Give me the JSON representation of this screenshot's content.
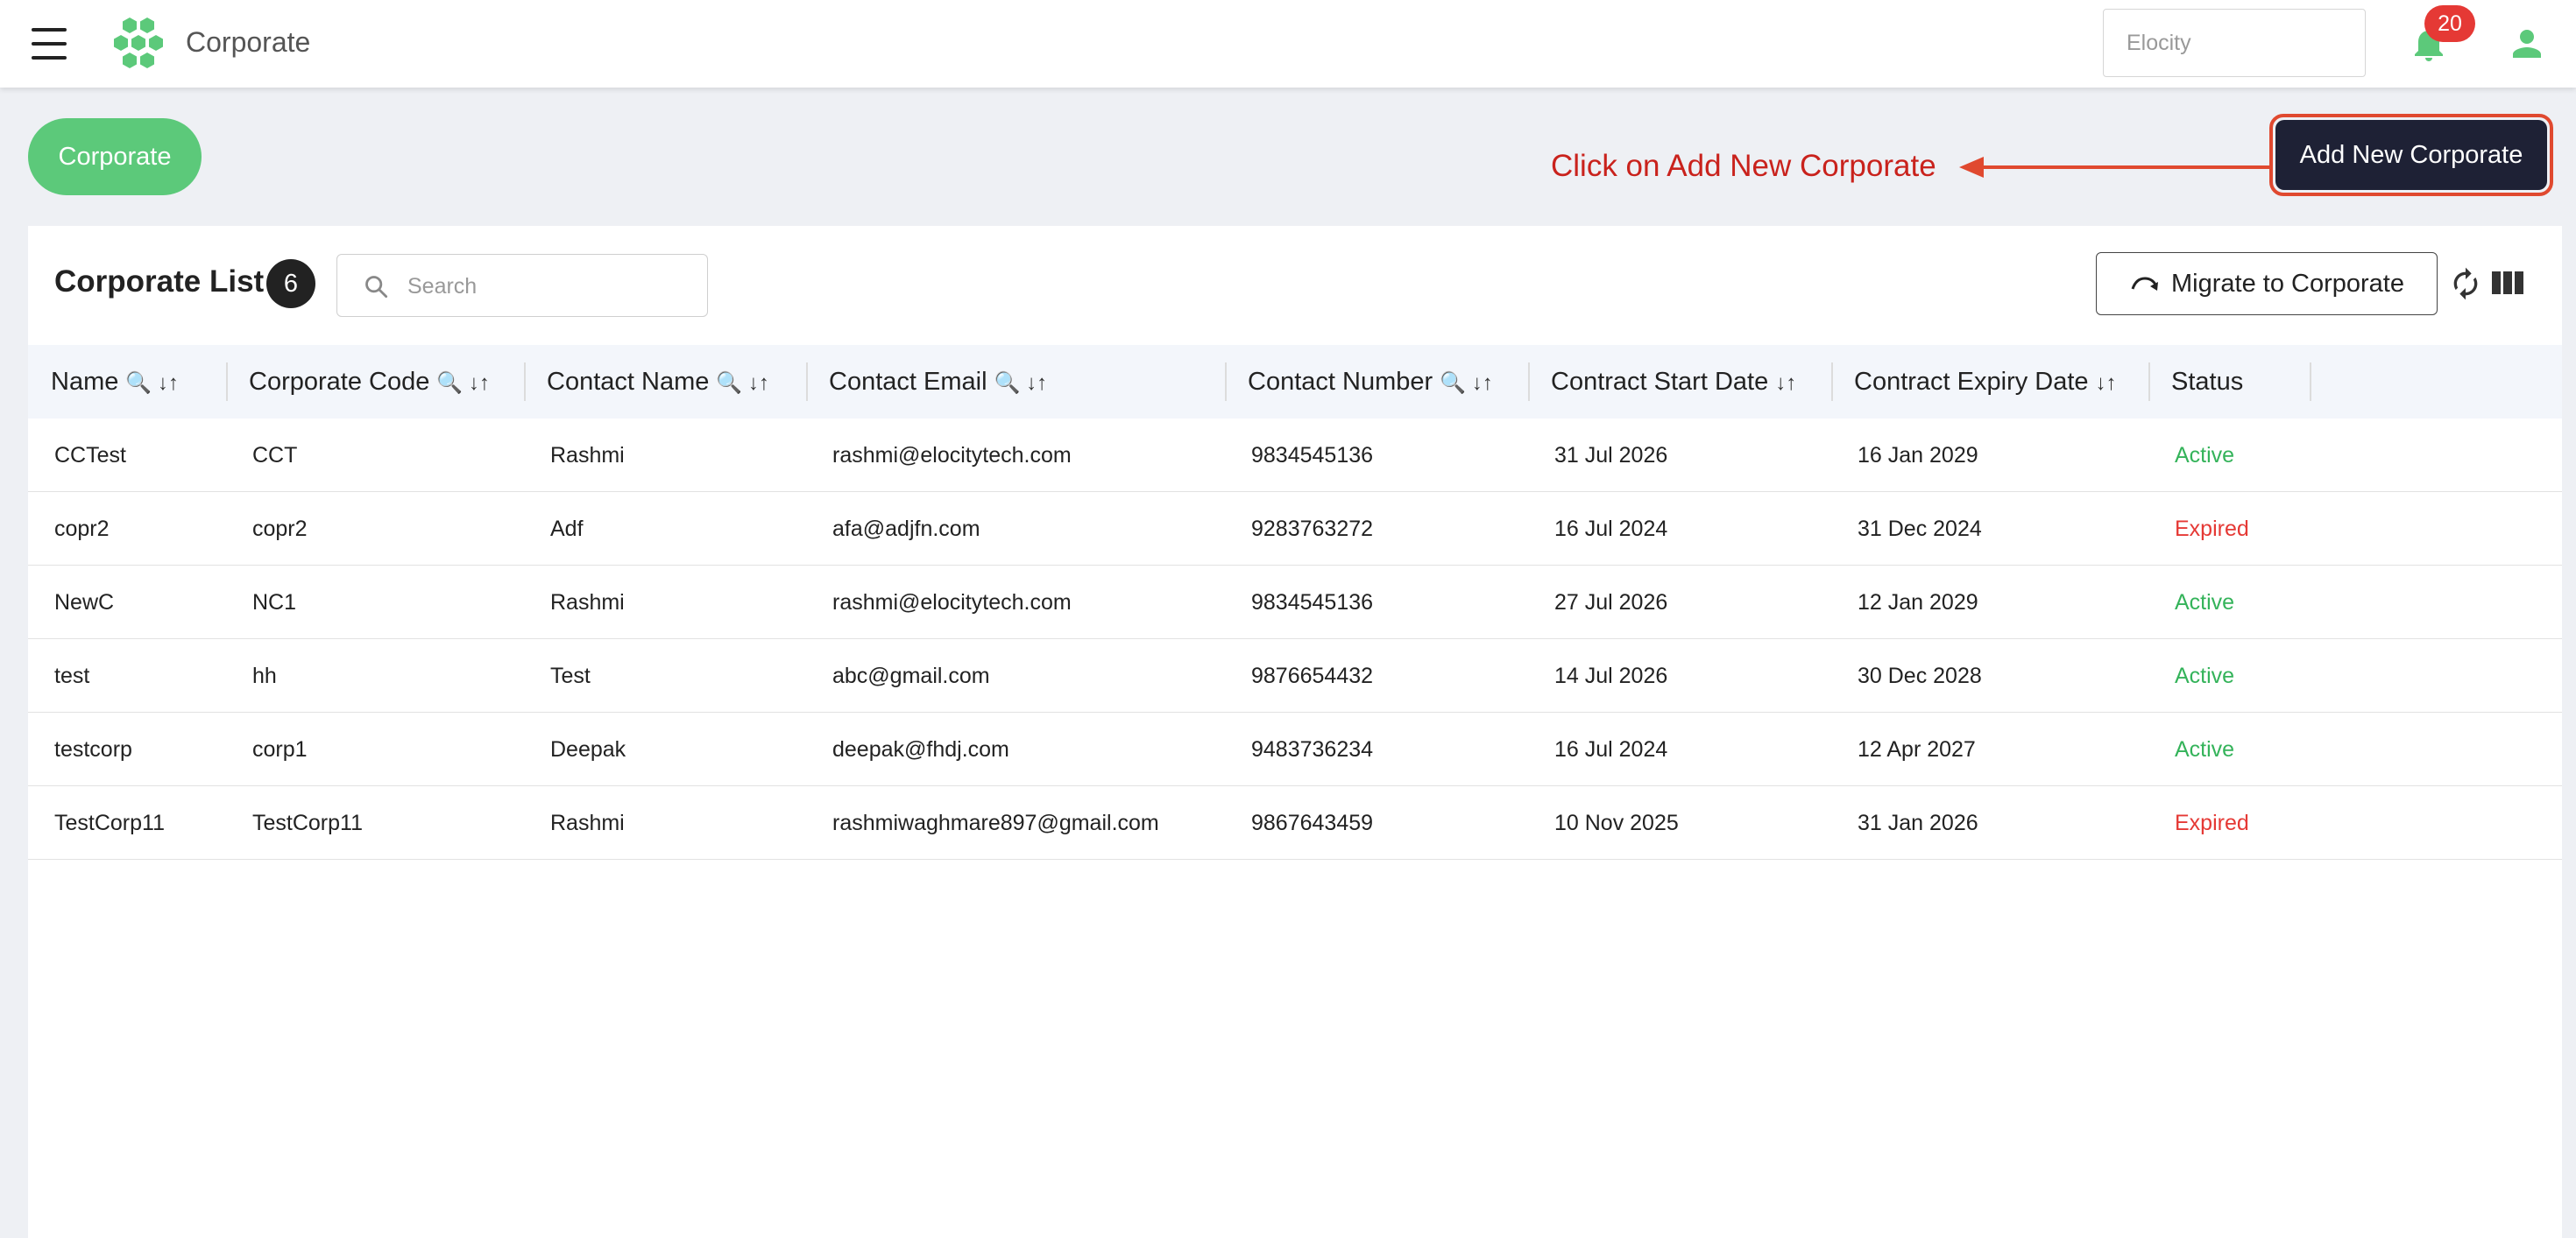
{
  "header": {
    "app_title": "Corporate",
    "org_placeholder": "Elocity",
    "notification_count": "20"
  },
  "page": {
    "tab_label": "Corporate",
    "annotation": "Click on Add New Corporate",
    "add_button_label": "Add New Corporate"
  },
  "list": {
    "title": "Corporate List",
    "count": "6",
    "search_placeholder": "Search",
    "migrate_button_label": "Migrate to Corporate"
  },
  "colors": {
    "brand_green": "#5cc97a",
    "active": "#34b35a",
    "expired": "#e53935",
    "annotation_red": "#c9221c",
    "dark_button": "#1e2135"
  },
  "columns": [
    {
      "label": "Name",
      "tools": "🔍 ↓↑"
    },
    {
      "label": "Corporate Code",
      "tools": "🔍 ↓↑"
    },
    {
      "label": "Contact Name",
      "tools": "🔍 ↓↑"
    },
    {
      "label": "Contact Email",
      "tools": "🔍 ↓↑"
    },
    {
      "label": "Contact Number",
      "tools": "🔍 ↓↑"
    },
    {
      "label": "Contract Start Date",
      "tools": "↓↑"
    },
    {
      "label": "Contract Expiry Date",
      "tools": "↓↑"
    },
    {
      "label": "Status",
      "tools": ""
    }
  ],
  "rows": [
    {
      "name": "CCTest",
      "code": "CCT",
      "contact_name": "Rashmi",
      "email": "rashmi@elocitytech.com",
      "number": "9834545136",
      "start": "31 Jul 2026",
      "expiry": "16 Jan 2029",
      "status": "Active"
    },
    {
      "name": "copr2",
      "code": "copr2",
      "contact_name": "Adf",
      "email": "afa@adjfn.com",
      "number": "9283763272",
      "start": "16 Jul 2024",
      "expiry": "31 Dec 2024",
      "status": "Expired"
    },
    {
      "name": "NewC",
      "code": "NC1",
      "contact_name": "Rashmi",
      "email": "rashmi@elocitytech.com",
      "number": "9834545136",
      "start": "27 Jul 2026",
      "expiry": "12 Jan 2029",
      "status": "Active"
    },
    {
      "name": "test",
      "code": "hh",
      "contact_name": "Test",
      "email": "abc@gmail.com",
      "number": "9876654432",
      "start": "14 Jul 2026",
      "expiry": "30 Dec 2028",
      "status": "Active"
    },
    {
      "name": "testcorp",
      "code": "corp1",
      "contact_name": "Deepak",
      "email": "deepak@fhdj.com",
      "number": "9483736234",
      "start": "16 Jul 2024",
      "expiry": "12 Apr 2027",
      "status": "Active"
    },
    {
      "name": "TestCorp11",
      "code": "TestCorp11",
      "contact_name": "Rashmi",
      "email": "rashmiwaghmare897@gmail.com",
      "number": "9867643459",
      "start": "10 Nov 2025",
      "expiry": "31 Jan 2026",
      "status": "Expired"
    }
  ]
}
